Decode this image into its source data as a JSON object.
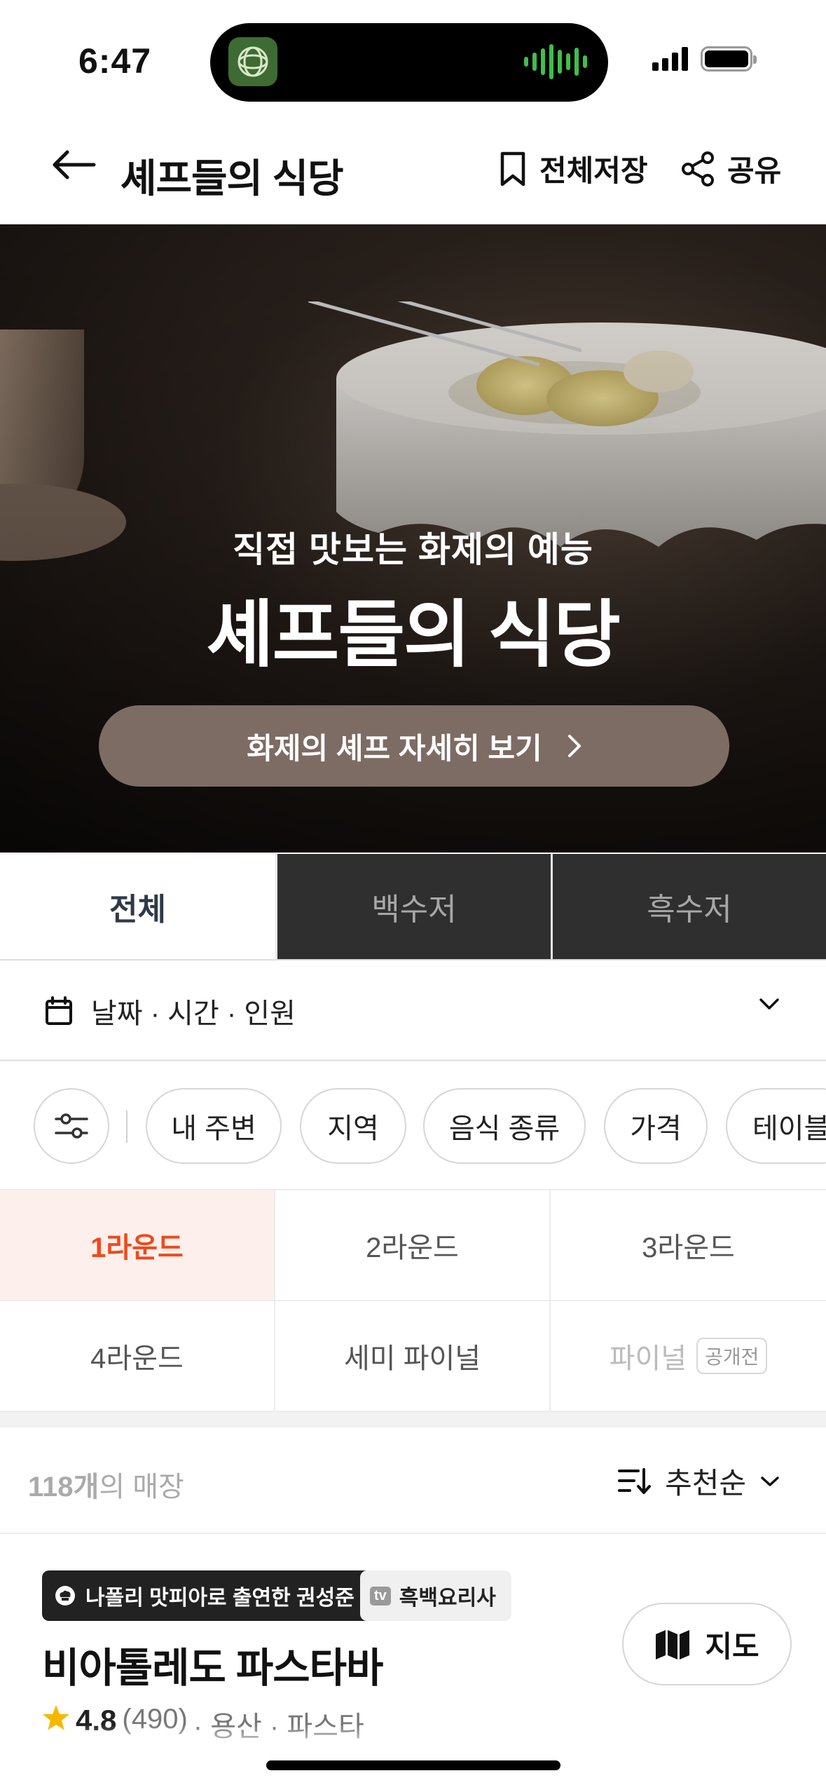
{
  "status_bar": {
    "time": "6:47"
  },
  "header": {
    "title": "셰프들의 식당",
    "save_all_label": "전체저장",
    "share_label": "공유"
  },
  "hero": {
    "subtitle": "직접 맛보는 화제의 예능",
    "title": "셰프들의 식당",
    "cta_label": "화제의 셰프 자세히 보기"
  },
  "tabs": [
    {
      "label": "전체",
      "active": true
    },
    {
      "label": "백수저",
      "active": false
    },
    {
      "label": "흑수저",
      "active": false
    }
  ],
  "date_selector": {
    "label": "날짜 · 시간 · 인원"
  },
  "filters": {
    "chips": [
      "내 주변",
      "지역",
      "음식 종류",
      "가격",
      "테이블"
    ]
  },
  "rounds": [
    {
      "label": "1라운드",
      "state": "active"
    },
    {
      "label": "2라운드",
      "state": "normal"
    },
    {
      "label": "3라운드",
      "state": "normal"
    },
    {
      "label": "4라운드",
      "state": "normal"
    },
    {
      "label": "세미 파이널",
      "state": "normal"
    },
    {
      "label": "파이널",
      "state": "disabled",
      "badge": "공개전"
    }
  ],
  "list": {
    "count_number": "118개",
    "count_suffix": "의 매장",
    "sort_label": "추천순"
  },
  "card": {
    "tag_primary": "나폴리 맛피아로 출연한 권성준",
    "tag_tv_icon": "tv",
    "tag_secondary": "흑백요리사",
    "name": "비아톨레도 파스타바",
    "rating": "4.8",
    "review_count": "(490)",
    "meta": "· 용산 · 파스타",
    "map_label": "지도"
  },
  "colors": {
    "accent": "#ef4a1c",
    "accent_bg": "#fdf0ec",
    "cta_bg": "#7d6c64",
    "dark_tab_bg": "#2f2f2f",
    "title_navy": "#2e3a47"
  }
}
